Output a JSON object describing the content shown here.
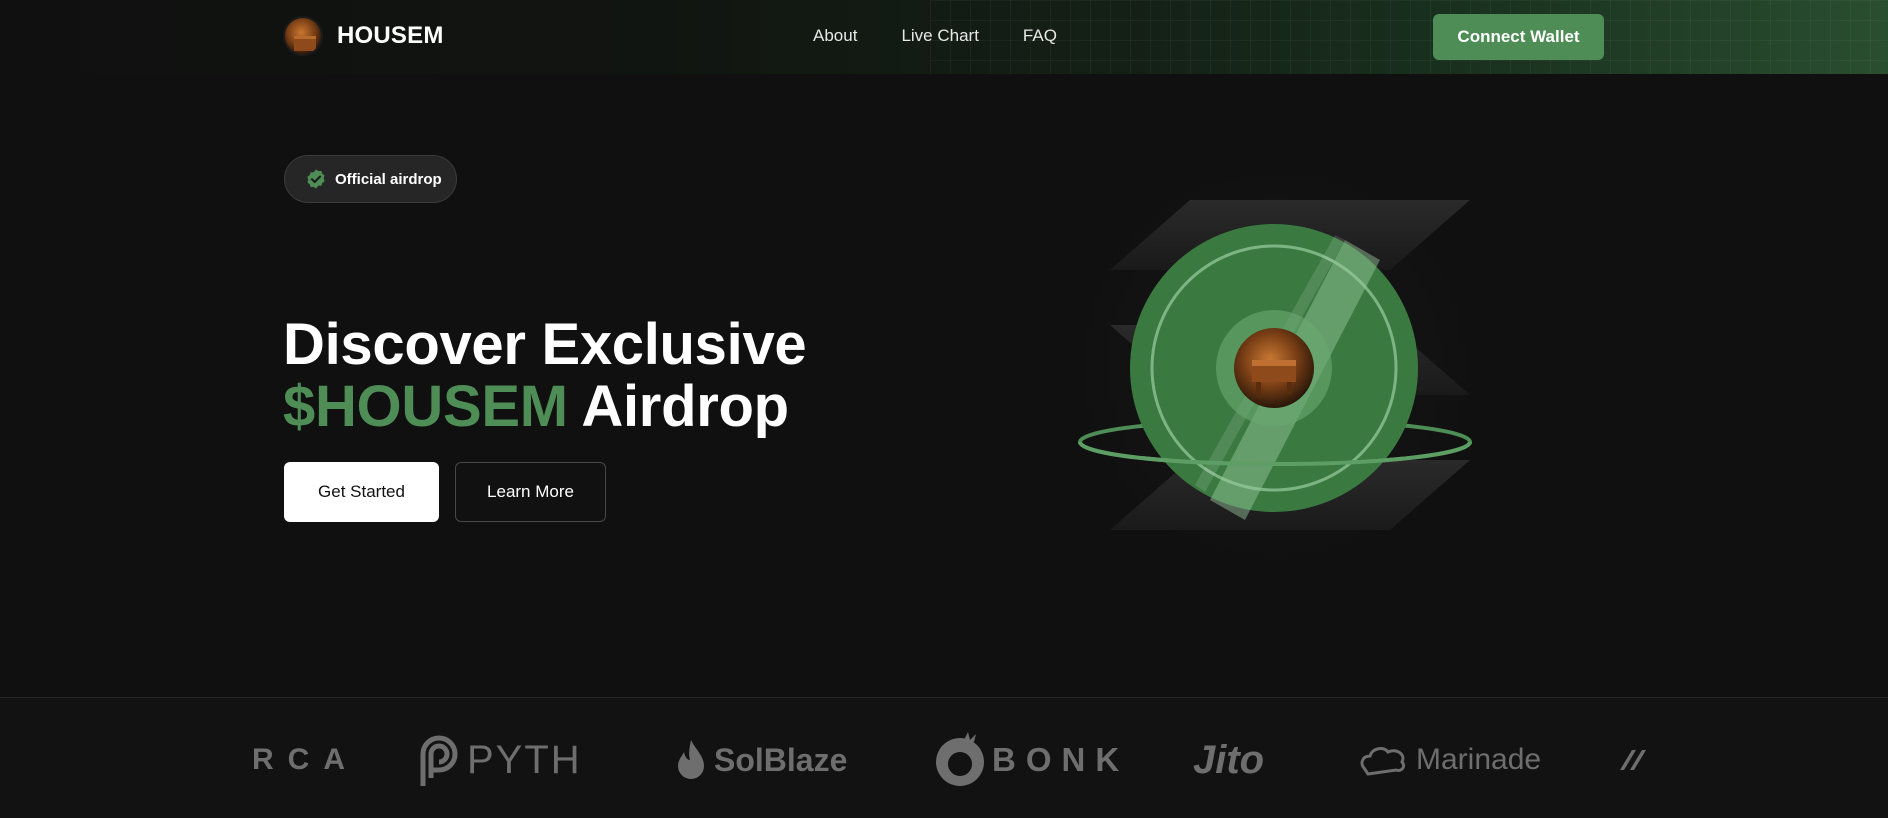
{
  "header": {
    "brand_name": "HOUSEM",
    "logo_icon": "housem-logo-icon",
    "nav": [
      {
        "label": "About"
      },
      {
        "label": "Live Chart"
      },
      {
        "label": "FAQ"
      }
    ],
    "connect_label": "Connect Wallet"
  },
  "hero": {
    "badge_text": "Official airdrop",
    "badge_icon": "verified-check-icon",
    "title_line1": "Discover Exclusive",
    "title_accent": "$HOUSEM",
    "title_rest": " Airdrop",
    "primary_label": "Get Started",
    "secondary_label": "Learn More",
    "art_icon": "housem-coin-icon"
  },
  "partners": [
    {
      "label": "RCA"
    },
    {
      "label": "PYTH"
    },
    {
      "label": "SolBlaze"
    },
    {
      "label": "BONK"
    },
    {
      "label": "Jito"
    },
    {
      "label": "Marinade"
    }
  ],
  "colors": {
    "accent": "#4e8d55",
    "background": "#101010",
    "partner_gray": "#6e6e6e"
  }
}
